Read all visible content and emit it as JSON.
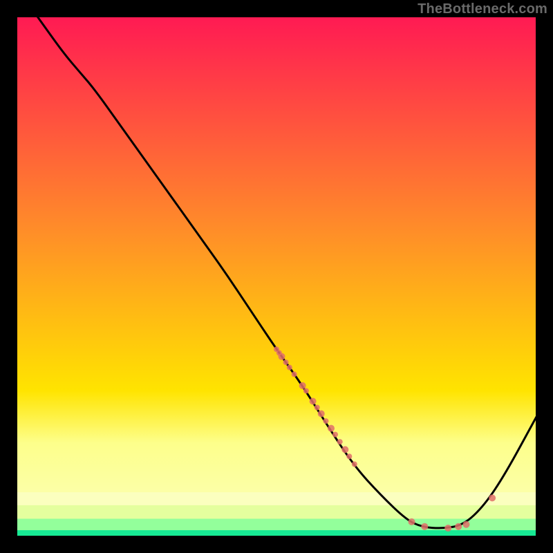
{
  "attribution": "TheBottleneck.com",
  "colors": {
    "top_gradient": "#ff1a53",
    "mid_gradient": "#ffe400",
    "band1": "#fbffbf",
    "band2": "#e4ff9e",
    "band3": "#93ff9b",
    "band4": "#17e994",
    "curve": "#000000",
    "dots": "#e07068",
    "frame_bg": "#000000"
  },
  "chart_data": {
    "type": "line",
    "title": "",
    "xlabel": "",
    "ylabel": "",
    "xlim": [
      0,
      100
    ],
    "ylim": [
      0,
      100
    ],
    "legend": null,
    "annotations": [],
    "curve": [
      {
        "x": 4,
        "y": 100
      },
      {
        "x": 9,
        "y": 93
      },
      {
        "x": 12,
        "y": 89.5
      },
      {
        "x": 15,
        "y": 86
      },
      {
        "x": 20,
        "y": 79
      },
      {
        "x": 25,
        "y": 72
      },
      {
        "x": 30,
        "y": 65
      },
      {
        "x": 35,
        "y": 58
      },
      {
        "x": 40,
        "y": 51
      },
      {
        "x": 45,
        "y": 43.5
      },
      {
        "x": 50,
        "y": 36
      },
      {
        "x": 55,
        "y": 29
      },
      {
        "x": 60,
        "y": 21
      },
      {
        "x": 65,
        "y": 13.5
      },
      {
        "x": 70,
        "y": 8
      },
      {
        "x": 75,
        "y": 3.2
      },
      {
        "x": 78,
        "y": 1.8
      },
      {
        "x": 82,
        "y": 1.5
      },
      {
        "x": 86,
        "y": 2.2
      },
      {
        "x": 90,
        "y": 6
      },
      {
        "x": 94,
        "y": 12
      },
      {
        "x": 100,
        "y": 23
      }
    ],
    "scatter": [
      {
        "x": 50,
        "y": 36.0,
        "r": 4
      },
      {
        "x": 50.5,
        "y": 35.3,
        "r": 4
      },
      {
        "x": 51,
        "y": 34.6,
        "r": 5
      },
      {
        "x": 51.8,
        "y": 33.5,
        "r": 4
      },
      {
        "x": 52.5,
        "y": 32.5,
        "r": 4
      },
      {
        "x": 53.4,
        "y": 31.2,
        "r": 4
      },
      {
        "x": 55,
        "y": 29.0,
        "r": 5
      },
      {
        "x": 55.7,
        "y": 28.0,
        "r": 4
      },
      {
        "x": 57,
        "y": 26.0,
        "r": 5
      },
      {
        "x": 57.8,
        "y": 24.8,
        "r": 4
      },
      {
        "x": 58.6,
        "y": 23.6,
        "r": 5
      },
      {
        "x": 59.5,
        "y": 22.2,
        "r": 4
      },
      {
        "x": 60.5,
        "y": 20.8,
        "r": 5
      },
      {
        "x": 61.3,
        "y": 19.6,
        "r": 4
      },
      {
        "x": 62.2,
        "y": 18.2,
        "r": 4
      },
      {
        "x": 63.2,
        "y": 16.7,
        "r": 5
      },
      {
        "x": 64,
        "y": 15.4,
        "r": 4
      },
      {
        "x": 65,
        "y": 13.9,
        "r": 4
      },
      {
        "x": 76,
        "y": 2.8,
        "r": 5
      },
      {
        "x": 78.5,
        "y": 1.9,
        "r": 5
      },
      {
        "x": 83,
        "y": 1.6,
        "r": 5
      },
      {
        "x": 85,
        "y": 1.9,
        "r": 5
      },
      {
        "x": 86.5,
        "y": 2.3,
        "r": 5
      },
      {
        "x": 91.5,
        "y": 7.4,
        "r": 5
      }
    ]
  }
}
